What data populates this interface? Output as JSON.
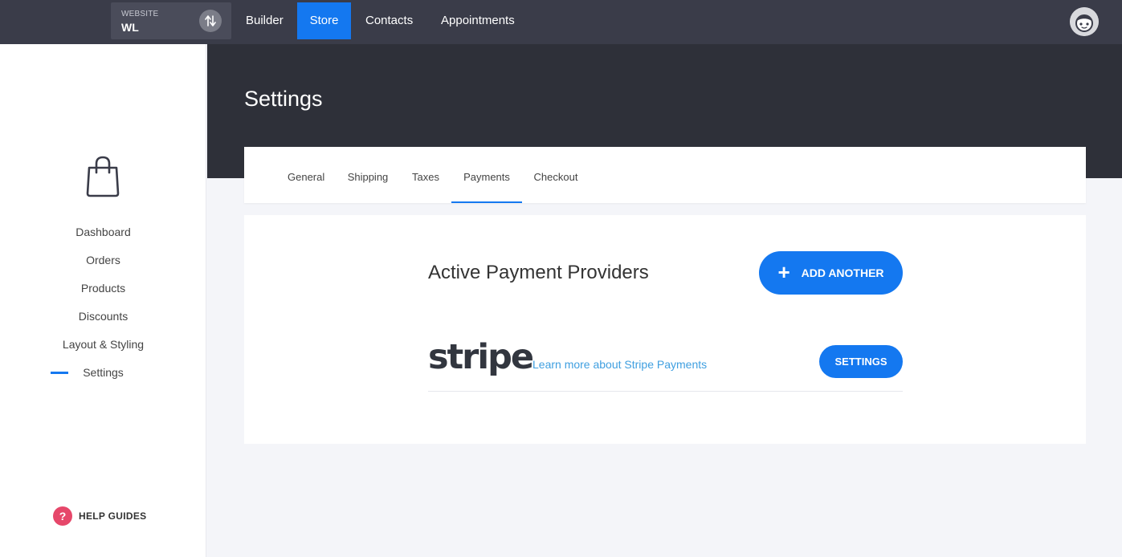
{
  "topbar": {
    "site_label": "WEBSITE",
    "site_value": "WL",
    "nav": [
      {
        "label": "Builder"
      },
      {
        "label": "Store"
      },
      {
        "label": "Contacts"
      },
      {
        "label": "Appointments"
      }
    ],
    "active_nav": "Store"
  },
  "sidebar": {
    "items": [
      {
        "label": "Dashboard"
      },
      {
        "label": "Orders"
      },
      {
        "label": "Products"
      },
      {
        "label": "Discounts"
      },
      {
        "label": "Layout & Styling"
      },
      {
        "label": "Settings"
      }
    ],
    "active_item": "Settings",
    "help_icon": "?",
    "help_label": "HELP GUIDES"
  },
  "page": {
    "title": "Settings",
    "tabs": [
      {
        "label": "General"
      },
      {
        "label": "Shipping"
      },
      {
        "label": "Taxes"
      },
      {
        "label": "Payments"
      },
      {
        "label": "Checkout"
      }
    ],
    "active_tab": "Payments"
  },
  "payments": {
    "section_title": "Active Payment Providers",
    "add_button_icon": "+",
    "add_button_label": "ADD ANOTHER",
    "provider_name": "stripe",
    "learn_more": "Learn more about Stripe Payments",
    "settings_button": "SETTINGS"
  },
  "colors": {
    "accent": "#1478f0",
    "topbar": "#3a3c49",
    "hero": "#2e3039",
    "help": "#e6476a",
    "link": "#3f9fe0"
  }
}
